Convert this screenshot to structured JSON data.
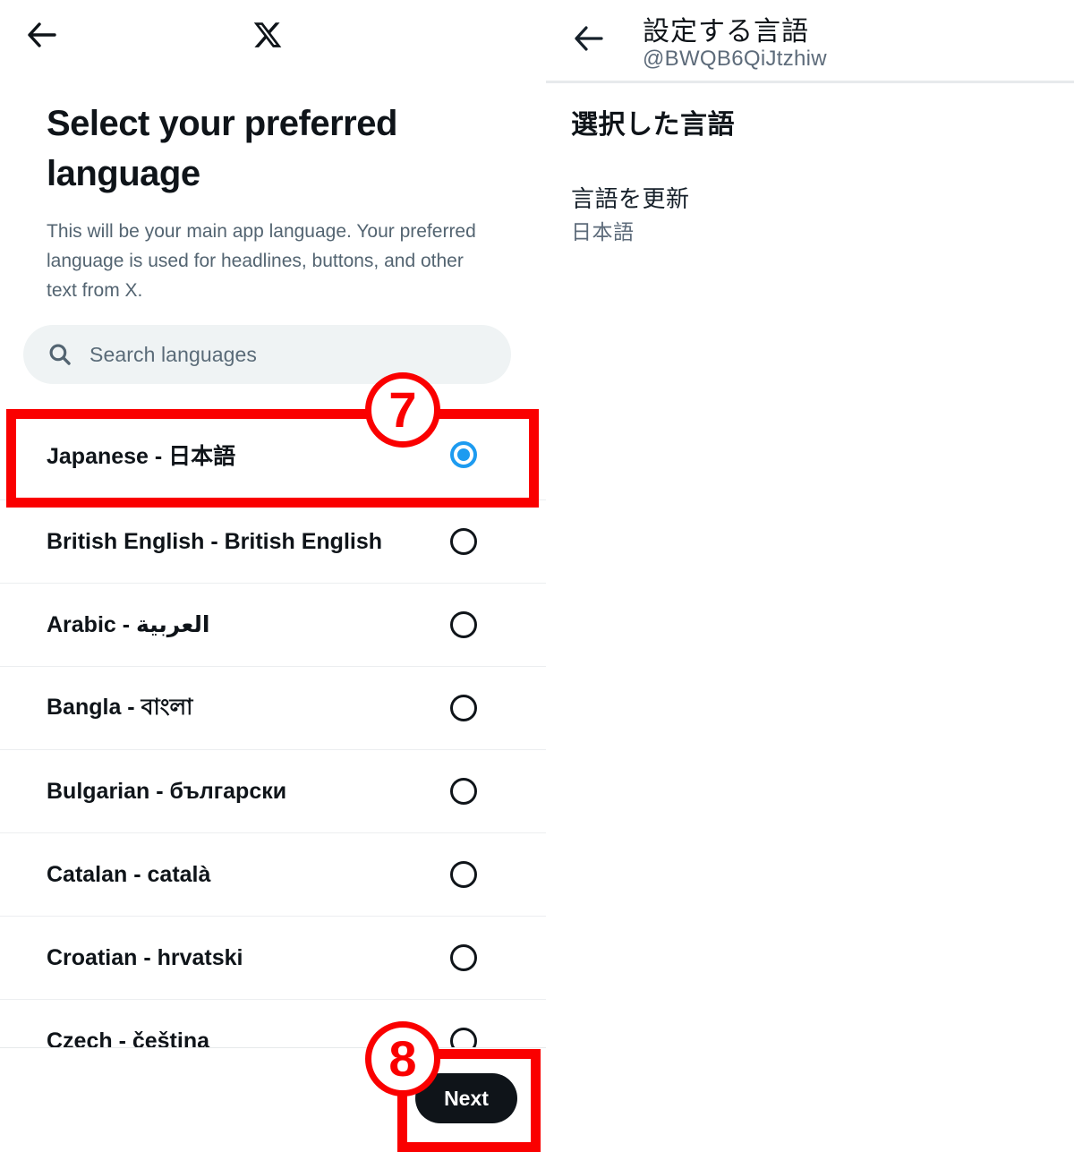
{
  "left_panel": {
    "topbar": {
      "back_icon": "back-arrow-icon",
      "logo_icon": "x-logo-icon"
    },
    "title": "Select your preferred language",
    "description": "This will be your main app language. Your preferred language is used for headlines, buttons, and other text from X.",
    "search": {
      "icon": "search-icon",
      "placeholder": "Search languages",
      "value": ""
    },
    "languages": [
      {
        "label": "Japanese - 日本語",
        "selected": true
      },
      {
        "label": "British English - British English",
        "selected": false
      },
      {
        "label": "Arabic - العربية",
        "selected": false
      },
      {
        "label": "Bangla - বাংলা",
        "selected": false
      },
      {
        "label": "Bulgarian - български",
        "selected": false
      },
      {
        "label": "Catalan - català",
        "selected": false
      },
      {
        "label": "Croatian - hrvatski",
        "selected": false
      },
      {
        "label": "Czech - čeština",
        "selected": false
      }
    ],
    "next_button": "Next"
  },
  "right_panel": {
    "back_icon": "back-arrow-icon",
    "title": "設定する言語",
    "handle": "@BWQB6QiJtzhiw",
    "section_title": "選択した言語",
    "item_label": "言語を更新",
    "item_value": "日本語"
  },
  "annotations": {
    "badge_7": "7",
    "badge_8": "8",
    "color": "#fa0000"
  },
  "colors": {
    "accent_blue": "#1d9bf0",
    "text_primary": "#0f1419",
    "text_secondary": "#536471",
    "search_bg": "#eff3f4",
    "button_bg": "#0f1419",
    "annotation_red": "#fa0000"
  }
}
